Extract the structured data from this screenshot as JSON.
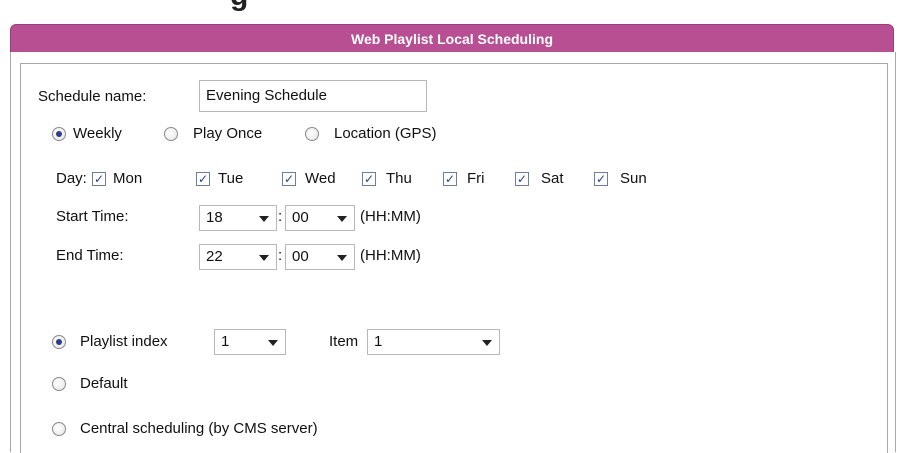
{
  "header": {
    "partial_text": "g",
    "title": "Web Playlist Local Scheduling"
  },
  "form": {
    "schedule_name_label": "Schedule name:",
    "schedule_name_value": "Evening Schedule",
    "mode_options": [
      {
        "label": "Weekly",
        "selected": true
      },
      {
        "label": "Play Once",
        "selected": false
      },
      {
        "label": "Location (GPS)",
        "selected": false
      }
    ],
    "day_label": "Day:",
    "days": [
      {
        "label": "Mon",
        "checked": true
      },
      {
        "label": "Tue",
        "checked": true
      },
      {
        "label": "Wed",
        "checked": true
      },
      {
        "label": "Thu",
        "checked": true
      },
      {
        "label": "Fri",
        "checked": true
      },
      {
        "label": "Sat",
        "checked": true
      },
      {
        "label": "Sun",
        "checked": true
      }
    ],
    "start_time_label": "Start Time:",
    "start_hour": "18",
    "start_minute": "00",
    "end_time_label": "End Time:",
    "end_hour": "22",
    "end_minute": "00",
    "colon": ":",
    "time_format_hint": "(HH:MM)",
    "source_options": [
      {
        "label": "Playlist index",
        "selected": true
      },
      {
        "label": "Default",
        "selected": false
      },
      {
        "label": "Central scheduling (by CMS server)",
        "selected": false
      }
    ],
    "playlist_index_value": "1",
    "item_label": "Item",
    "item_value": "1"
  }
}
